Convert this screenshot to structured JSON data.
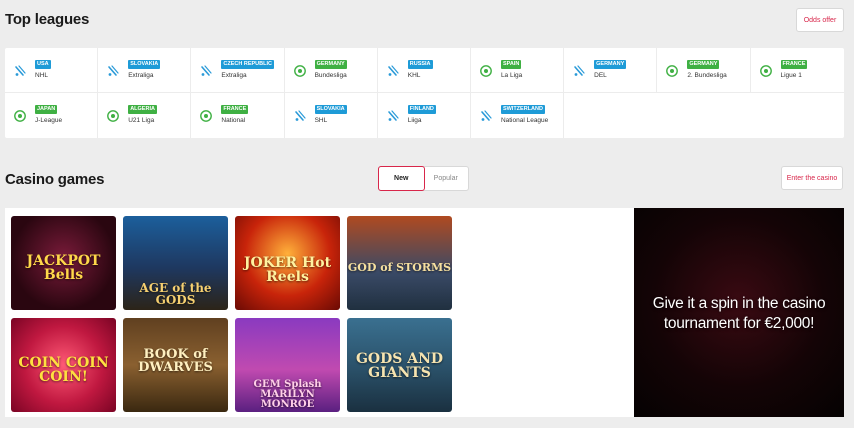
{
  "top_leagues": {
    "title": "Top leagues",
    "odds_offer_label": "Odds offer",
    "items": [
      {
        "country": "USA",
        "league": "NHL",
        "sport": "hockey"
      },
      {
        "country": "SLOVAKIA",
        "league": "Extraliga",
        "sport": "hockey"
      },
      {
        "country": "CZECH REPUBLIC",
        "league": "Extraliga",
        "sport": "hockey"
      },
      {
        "country": "GERMANY",
        "league": "Bundesliga",
        "sport": "soccer"
      },
      {
        "country": "RUSSIA",
        "league": "KHL",
        "sport": "hockey"
      },
      {
        "country": "SPAIN",
        "league": "La Liga",
        "sport": "soccer"
      },
      {
        "country": "GERMANY",
        "league": "DEL",
        "sport": "hockey"
      },
      {
        "country": "GERMANY",
        "league": "2. Bundesliga",
        "sport": "soccer"
      },
      {
        "country": "FRANCE",
        "league": "Ligue 1",
        "sport": "soccer"
      },
      {
        "country": "JAPAN",
        "league": "J-League",
        "sport": "soccer"
      },
      {
        "country": "ALGERIA",
        "league": "U21 Liga",
        "sport": "soccer"
      },
      {
        "country": "FRANCE",
        "league": "National",
        "sport": "soccer"
      },
      {
        "country": "SLOVAKIA",
        "league": "SHL",
        "sport": "hockey"
      },
      {
        "country": "FINLAND",
        "league": "Liiga",
        "sport": "hockey"
      },
      {
        "country": "SWITZERLAND",
        "league": "National League",
        "sport": "hockey"
      }
    ]
  },
  "casino_games": {
    "title": "Casino games",
    "tabs": [
      {
        "label": "New",
        "active": true
      },
      {
        "label": "Popular",
        "active": false
      }
    ],
    "enter_label": "Enter the casino",
    "games": [
      {
        "name": "JACKPOT Bells"
      },
      {
        "name": "AGE of the GODS"
      },
      {
        "name": "JOKER Hot Reels"
      },
      {
        "name": "GOD of STORMS"
      },
      {
        "name": "COIN COIN COIN!"
      },
      {
        "name": "BOOK of DWARVES"
      },
      {
        "name": "GEM Splash MARILYN MONROE"
      },
      {
        "name": "GODS AND GIANTS"
      }
    ]
  },
  "promo": {
    "text": "Give it a spin in the casino tournament for €2,000!"
  },
  "colors": {
    "accent": "#d8264a",
    "hockey_badge": "#1e9bd7",
    "soccer_badge": "#3fb043"
  }
}
